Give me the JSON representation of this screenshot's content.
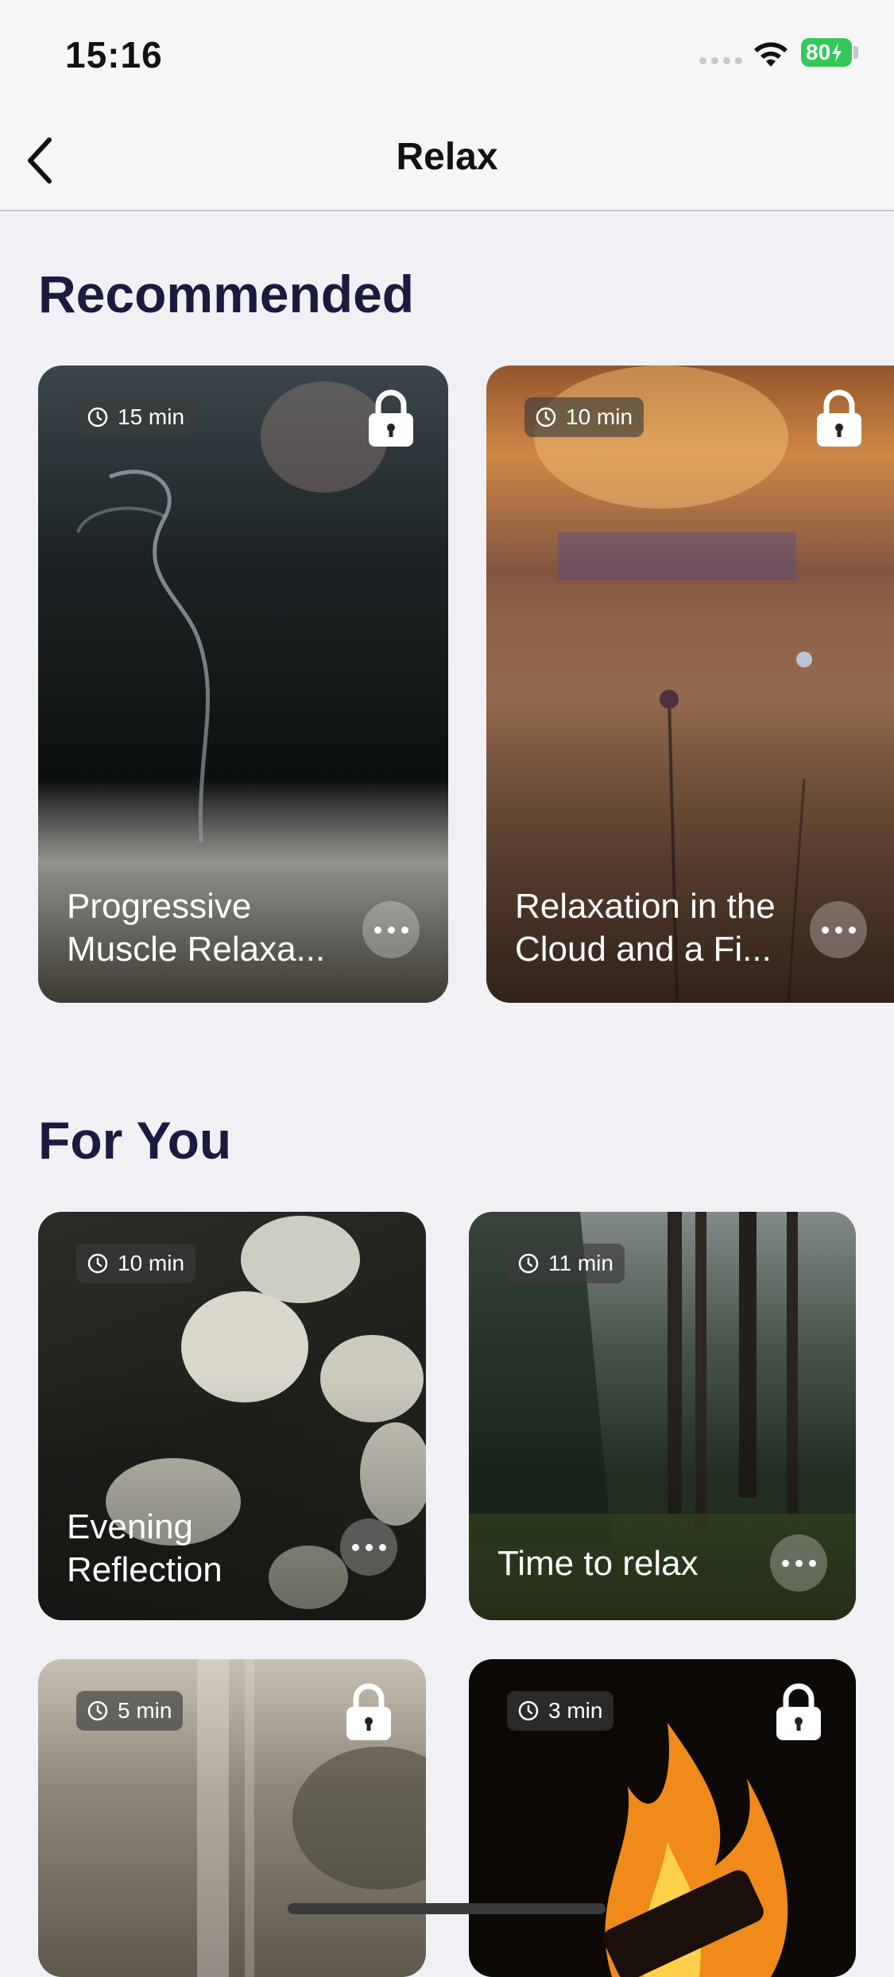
{
  "status": {
    "time": "15:16",
    "battery": "80"
  },
  "nav": {
    "title": "Relax"
  },
  "sections": {
    "recommended": "Recommended",
    "for_you": "For You"
  },
  "recommended": [
    {
      "duration": "15 min",
      "title": "Progressive Muscle Relaxa...",
      "locked": true
    },
    {
      "duration": "10 min",
      "title": "Relaxation in the Cloud and a Fi...",
      "locked": true
    }
  ],
  "for_you": [
    {
      "duration": "10 min",
      "title": "Evening Reflection",
      "locked": false
    },
    {
      "duration": "11 min",
      "title": "Time to relax",
      "locked": false
    },
    {
      "duration": "5 min",
      "title": "",
      "locked": true
    },
    {
      "duration": "3 min",
      "title": "",
      "locked": true
    }
  ],
  "icons": {
    "back": "chevron-left-icon",
    "timer": "timer-icon",
    "lock": "lock-icon",
    "more": "more-icon",
    "wifi": "wifi-icon"
  },
  "colors": {
    "background": "#f1f0f5",
    "heading": "#1b1a40",
    "battery": "#34c759"
  }
}
